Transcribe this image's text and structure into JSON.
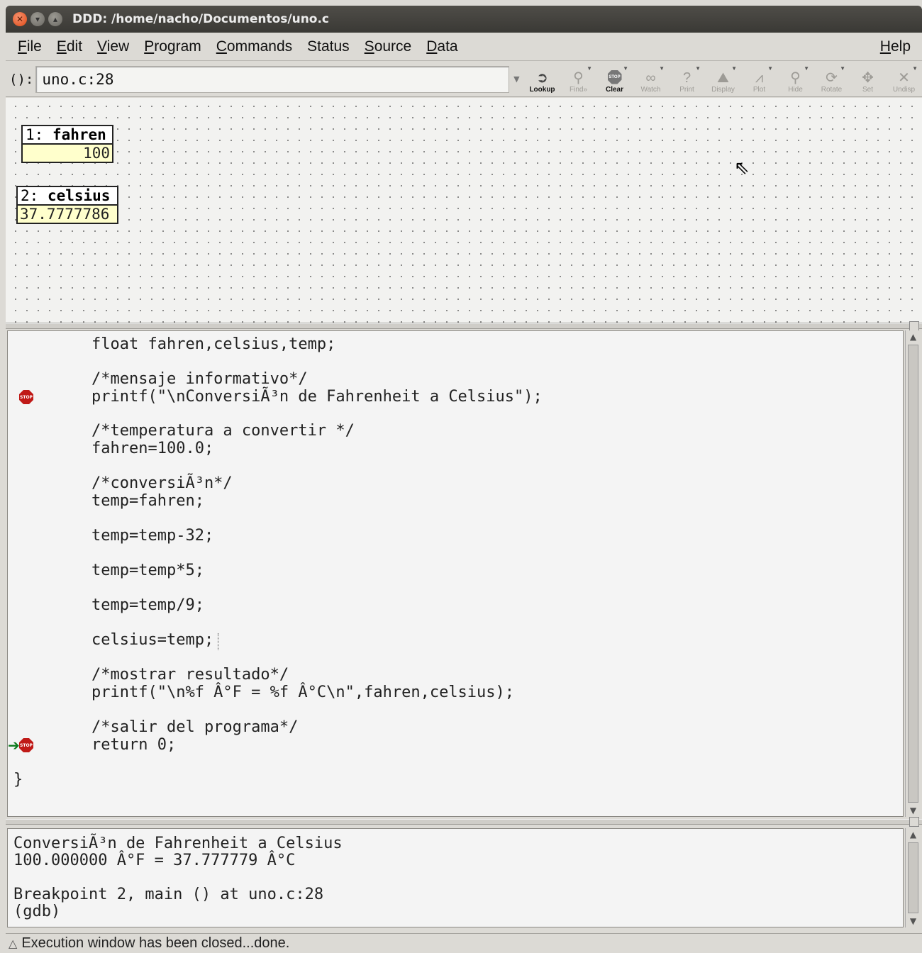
{
  "window": {
    "title": "DDD: /home/nacho/Documentos/uno.c"
  },
  "menubar": {
    "items": [
      {
        "pre": "",
        "u": "F",
        "post": "ile"
      },
      {
        "pre": "",
        "u": "E",
        "post": "dit"
      },
      {
        "pre": "",
        "u": "V",
        "post": "iew"
      },
      {
        "pre": "",
        "u": "P",
        "post": "rogram"
      },
      {
        "pre": "",
        "u": "C",
        "post": "ommands"
      },
      {
        "pre": "",
        "u": "S",
        "post": "tatus"
      },
      {
        "pre": "",
        "u": "S",
        "post": "ource"
      },
      {
        "pre": "",
        "u": "D",
        "post": "ata"
      }
    ],
    "help": {
      "pre": "",
      "u": "H",
      "post": "elp"
    }
  },
  "toolbar": {
    "arg_label": "():",
    "arg_value": "uno.c:28",
    "buttons": [
      {
        "label": "Lookup",
        "icon": "lookup-icon",
        "glyph": "➲",
        "enabled": true,
        "caret": false
      },
      {
        "label": "Find»",
        "icon": "binoculars-icon",
        "glyph": "⚲",
        "enabled": false,
        "caret": true
      },
      {
        "label": "Clear",
        "icon": "stop-icon",
        "glyph": "STOP",
        "enabled": true,
        "caret": true
      },
      {
        "label": "Watch",
        "icon": "watch-glasses-icon",
        "glyph": "∞",
        "enabled": false,
        "caret": true
      },
      {
        "label": "Print",
        "icon": "question-icon",
        "glyph": "?",
        "enabled": false,
        "caret": true
      },
      {
        "label": "Display",
        "icon": "display-icon",
        "glyph": "⛰",
        "enabled": false,
        "caret": true
      },
      {
        "label": "Plot",
        "icon": "plot-icon",
        "glyph": "⩘",
        "enabled": false,
        "caret": true
      },
      {
        "label": "Hide",
        "icon": "magnifier-icon",
        "glyph": "⚲",
        "enabled": false,
        "caret": true
      },
      {
        "label": "Rotate",
        "icon": "rotate-icon",
        "glyph": "⟳",
        "enabled": false,
        "caret": true
      },
      {
        "label": "Set",
        "icon": "set-icon",
        "glyph": "✥",
        "enabled": false,
        "caret": false
      },
      {
        "label": "Undisp",
        "icon": "undisplay-icon",
        "glyph": "✕",
        "enabled": false,
        "caret": true
      }
    ]
  },
  "data_window": {
    "displays": [
      {
        "num": "1:",
        "name": "fahren",
        "value": "100"
      },
      {
        "num": "2:",
        "name": "celsius",
        "value": "37.7777786"
      }
    ]
  },
  "source": {
    "lines": [
      "float fahren,celsius,temp;",
      "/*mensaje informativo*/",
      "printf(\"\\nConversiÃ³n de Fahrenheit a Celsius\");",
      "/*temperatura a convertir */",
      "fahren=100.0;",
      "/*conversiÃ³n*/",
      "temp=fahren;",
      "temp=temp-32;",
      "temp=temp*5;",
      "temp=temp/9;",
      "celsius=temp;",
      "/*mostrar resultado*/",
      "printf(\"\\n%f Â°F = %f Â°C\\n\",fahren,celsius);",
      "/*salir del programa*/",
      "return 0;",
      "}"
    ],
    "breakpoint_label": "STOP"
  },
  "console": {
    "lines": [
      "ConversiÃ³n de Fahrenheit a Celsius",
      "100.000000 Â°F = 37.777779 Â°C",
      "",
      "Breakpoint 2, main () at uno.c:28",
      "(gdb)"
    ]
  },
  "status": {
    "text": "Execution window has been closed...done."
  }
}
